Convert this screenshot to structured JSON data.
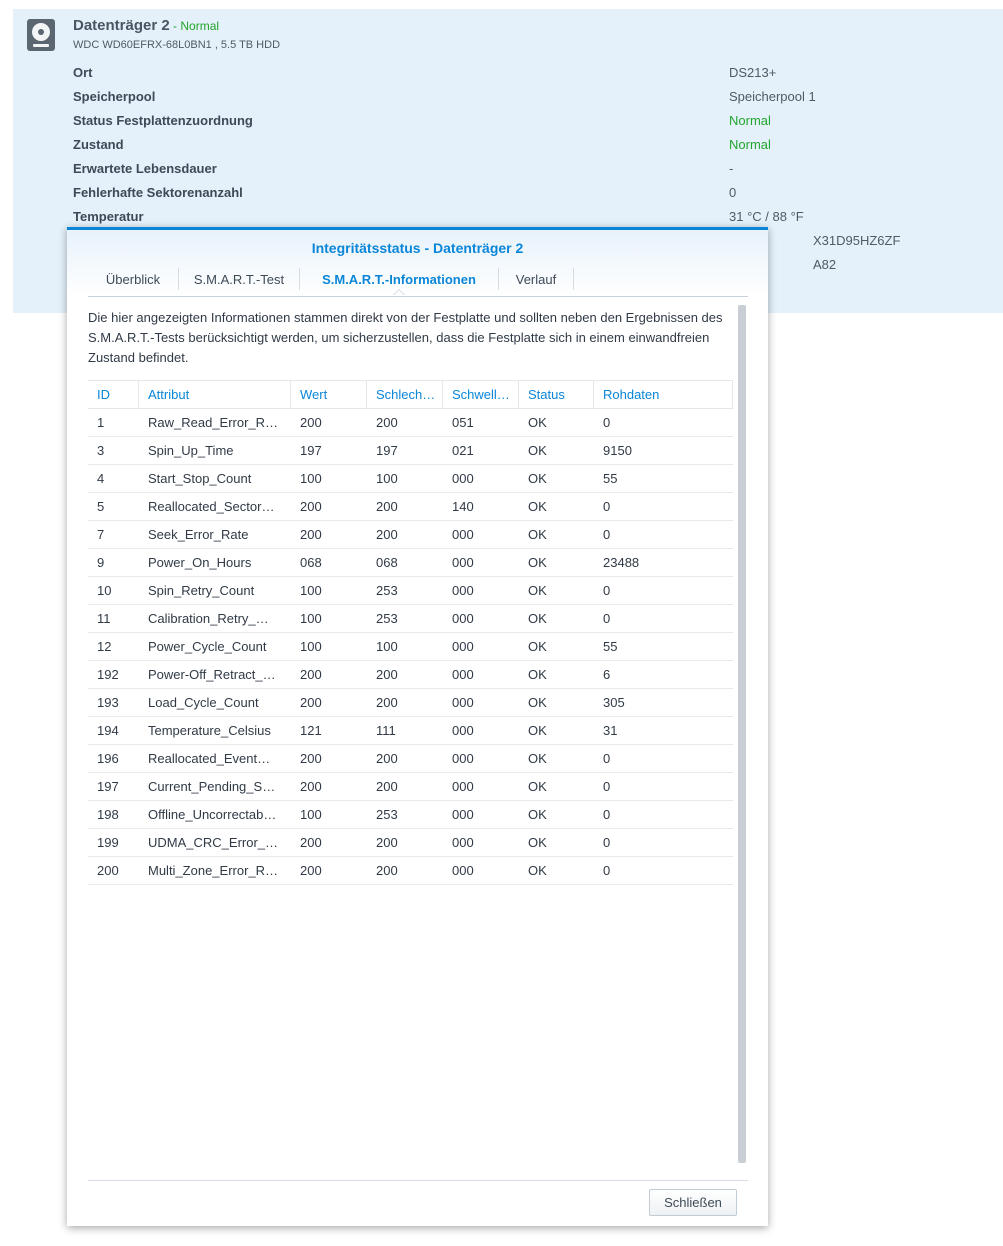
{
  "disk": {
    "title": "Datenträger 2",
    "separator": " - ",
    "state": "Normal",
    "model": "WDC WD60EFRX-68L0BN1 , 5.5 TB HDD",
    "properties": [
      {
        "label": "Ort",
        "value": "DS213+",
        "color": "default"
      },
      {
        "label": "Speicherpool",
        "value": "Speicherpool 1",
        "color": "default"
      },
      {
        "label": "Status Festplattenzuordnung",
        "value": "Normal",
        "color": "green"
      },
      {
        "label": "Zustand",
        "value": "Normal",
        "color": "green"
      },
      {
        "label": "Erwartete Lebensdauer",
        "value": "-",
        "color": "default"
      },
      {
        "label": "Fehlerhafte Sektorenanzahl",
        "value": "0",
        "color": "default"
      },
      {
        "label": "Temperatur",
        "value": "31 °C / 88 °F",
        "color": "default"
      },
      {
        "label": "",
        "value": "X31D95HZ6ZF",
        "color": "default"
      },
      {
        "label": "",
        "value": "A82",
        "color": "default"
      }
    ]
  },
  "dialog": {
    "title": "Integritätsstatus - Datenträger 2",
    "tabs": [
      "Überblick",
      "S.M.A.R.T.-Test",
      "S.M.A.R.T.-Informationen",
      "Verlauf"
    ],
    "active_tab": 2,
    "description": "Die hier angezeigten Informationen stammen direkt von der Festplatte und sollten neben den Ergebnissen des S.M.A.R.T.-Tests berücksichtigt werden, um sicherzustellen, dass die Festplatte sich in einem einwandfreien Zustand befindet.",
    "table": {
      "columns": [
        "ID",
        "Attribut",
        "Wert",
        "Schlech…",
        "Schwell…",
        "Status",
        "Rohdaten"
      ],
      "rows": [
        [
          "1",
          "Raw_Read_Error_R…",
          "200",
          "200",
          "051",
          "OK",
          "0"
        ],
        [
          "3",
          "Spin_Up_Time",
          "197",
          "197",
          "021",
          "OK",
          "9150"
        ],
        [
          "4",
          "Start_Stop_Count",
          "100",
          "100",
          "000",
          "OK",
          "55"
        ],
        [
          "5",
          "Reallocated_Sector…",
          "200",
          "200",
          "140",
          "OK",
          "0"
        ],
        [
          "7",
          "Seek_Error_Rate",
          "200",
          "200",
          "000",
          "OK",
          "0"
        ],
        [
          "9",
          "Power_On_Hours",
          "068",
          "068",
          "000",
          "OK",
          "23488"
        ],
        [
          "10",
          "Spin_Retry_Count",
          "100",
          "253",
          "000",
          "OK",
          "0"
        ],
        [
          "11",
          "Calibration_Retry_…",
          "100",
          "253",
          "000",
          "OK",
          "0"
        ],
        [
          "12",
          "Power_Cycle_Count",
          "100",
          "100",
          "000",
          "OK",
          "55"
        ],
        [
          "192",
          "Power-Off_Retract_…",
          "200",
          "200",
          "000",
          "OK",
          "6"
        ],
        [
          "193",
          "Load_Cycle_Count",
          "200",
          "200",
          "000",
          "OK",
          "305"
        ],
        [
          "194",
          "Temperature_Celsius",
          "121",
          "111",
          "000",
          "OK",
          "31"
        ],
        [
          "196",
          "Reallocated_Event…",
          "200",
          "200",
          "000",
          "OK",
          "0"
        ],
        [
          "197",
          "Current_Pending_S…",
          "200",
          "200",
          "000",
          "OK",
          "0"
        ],
        [
          "198",
          "Offline_Uncorrectab…",
          "100",
          "253",
          "000",
          "OK",
          "0"
        ],
        [
          "199",
          "UDMA_CRC_Error_…",
          "200",
          "200",
          "000",
          "OK",
          "0"
        ],
        [
          "200",
          "Multi_Zone_Error_R…",
          "200",
          "200",
          "000",
          "OK",
          "0"
        ]
      ]
    },
    "close_label": "Schließen"
  },
  "colors": {
    "accent": "#0a86d8",
    "status_green": "#22a52c",
    "panel_bg": "#e4f0fa"
  }
}
